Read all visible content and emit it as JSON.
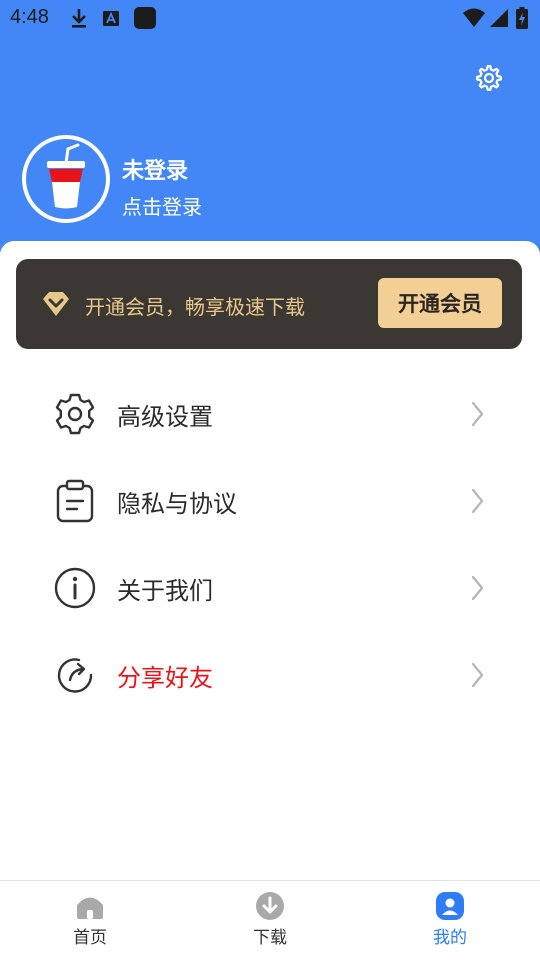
{
  "status_bar": {
    "time": "4:48",
    "icons": [
      "download-icon",
      "font-a-icon",
      "app-icon",
      "wifi-icon",
      "signal-icon",
      "battery-charging-icon"
    ]
  },
  "header": {
    "settings_icon": "gear-icon",
    "background_color": "#4287f5"
  },
  "profile": {
    "avatar_icon": "drink-cup-icon",
    "title": "未登录",
    "subtitle": "点击登录"
  },
  "vip": {
    "icon": "diamond-icon",
    "text": "开通会员，畅享极速下载",
    "button_label": "开通会员",
    "accent_color": "#f2cf95"
  },
  "menu": {
    "items": [
      {
        "label": "高级设置",
        "icon": "gear-icon"
      },
      {
        "label": "隐私与协议",
        "icon": "clipboard-icon"
      },
      {
        "label": "关于我们",
        "icon": "info-icon"
      },
      {
        "label": "分享好友",
        "icon": "share-icon",
        "color": "#e8141a"
      }
    ]
  },
  "bottom_nav": {
    "items": [
      {
        "label": "首页",
        "icon": "home-icon"
      },
      {
        "label": "下载",
        "icon": "download-circle-icon"
      },
      {
        "label": "我的",
        "icon": "user-icon",
        "active": true
      }
    ],
    "active_color": "#2f7cf6"
  }
}
